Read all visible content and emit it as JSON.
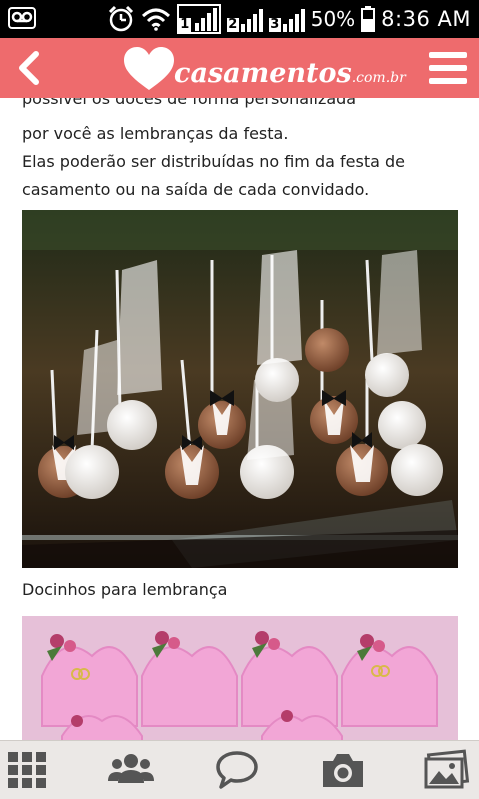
{
  "status_bar": {
    "battery": "50%",
    "time": "8:36 AM",
    "sim_labels": [
      "1",
      "2",
      "3"
    ],
    "icons": [
      "voicemail-icon",
      "alarm-icon",
      "wifi-icon",
      "signal-icon",
      "battery-icon"
    ]
  },
  "header": {
    "logo_text": "casamentos",
    "logo_domain": ".com.br",
    "icons": [
      "back-icon",
      "heart-logo-icon",
      "menu-icon"
    ],
    "accent_color": "#ee6b6d"
  },
  "article": {
    "cut_line": "possível os doces de forma personalizada",
    "paragraph_lines": [
      "por você as lembranças da festa.",
      "Elas poderão ser distribuídas no fim da festa de",
      "casamento ou na saída de cada convidado."
    ],
    "caption": "Docinhos para lembrança"
  },
  "bottom_nav": {
    "icons": [
      "apps-grid-icon",
      "people-icon",
      "chat-bubble-icon",
      "camera-icon",
      "gallery-icon"
    ]
  }
}
